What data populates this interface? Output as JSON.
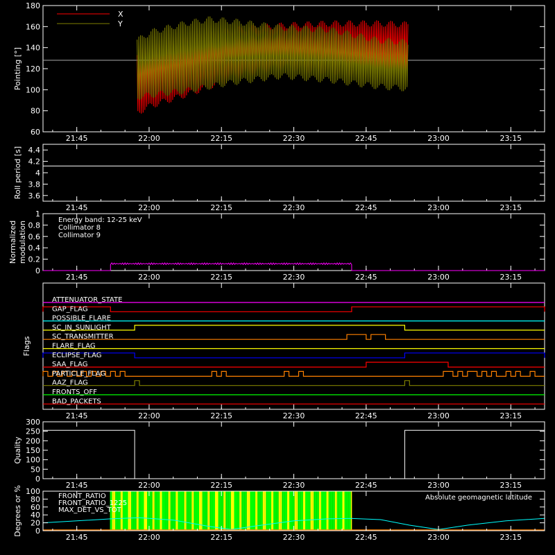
{
  "time_ticks": [
    "21:45",
    "22:00",
    "22:15",
    "22:30",
    "22:45",
    "23:00",
    "23:15"
  ],
  "chart_data": [
    {
      "type": "line",
      "ylabel": "Pointing [°]",
      "ylim": [
        60,
        180
      ],
      "yticks": [
        60,
        80,
        100,
        120,
        140,
        160,
        180
      ],
      "x_unit": "time",
      "reference_line": 128,
      "series": [
        {
          "name": "X",
          "color": "#ff0000",
          "band_start": "21:57:30",
          "band_end": "22:53:45",
          "upper": [
            [
              0,
              138
            ],
            [
              3,
              142
            ],
            [
              10,
              150
            ],
            [
              20,
              160
            ],
            [
              30,
              164
            ],
            [
              40,
              166
            ],
            [
              50,
              166
            ],
            [
              56.25,
              165
            ]
          ],
          "lower": [
            [
              0,
              75
            ],
            [
              3,
              82
            ],
            [
              10,
              92
            ],
            [
              20,
              108
            ],
            [
              30,
              118
            ],
            [
              40,
              114
            ],
            [
              50,
              112
            ],
            [
              56.25,
              110
            ]
          ]
        },
        {
          "name": "Y",
          "color": "#808000",
          "band_start": "21:57:30",
          "band_end": "22:53:45",
          "upper": [
            [
              0,
              150
            ],
            [
              3,
              158
            ],
            [
              10,
              166
            ],
            [
              15,
              170
            ],
            [
              20,
              168
            ],
            [
              30,
              162
            ],
            [
              40,
              160
            ],
            [
              50,
              150
            ],
            [
              56.25,
              148
            ]
          ],
          "lower": [
            [
              0,
              90
            ],
            [
              3,
              92
            ],
            [
              10,
              96
            ],
            [
              20,
              104
            ],
            [
              30,
              110
            ],
            [
              40,
              106
            ],
            [
              50,
              100
            ],
            [
              56.25,
              98
            ]
          ]
        }
      ],
      "legend": "top-left"
    },
    {
      "type": "line",
      "ylabel": "Roll period [s]",
      "ylim": [
        3.5,
        4.5
      ],
      "yticks": [
        3.6,
        3.8,
        4.0,
        4.2,
        4.4
      ],
      "series": [
        {
          "name": "",
          "color": "#ffffff",
          "x": [
            "21:38",
            "23:22"
          ],
          "y": [
            4.12,
            4.12
          ]
        }
      ]
    },
    {
      "type": "line",
      "ylabel": "Normalized modulation",
      "ylim": [
        0,
        1.0
      ],
      "yticks": [
        0.0,
        0.2,
        0.4,
        0.6,
        0.8,
        1.0
      ],
      "legend_lines": [
        "Energy band: 12-25 keV",
        "Collimator 8",
        "Collimator 9"
      ],
      "legend_colors": [
        "#ffffff",
        "#00ffff",
        "#ff00ff"
      ],
      "series": [
        {
          "name": "Collimator 9",
          "color": "#ff00ff",
          "x": [
            "21:38",
            "21:52",
            "21:52",
            "22:42",
            "22:42",
            "23:22"
          ],
          "y": [
            0.0,
            0.0,
            0.12,
            0.12,
            0.0,
            0.0
          ]
        }
      ]
    },
    {
      "type": "line",
      "ylabel": "Flags",
      "flags": [
        {
          "name": "ATTENUATOR_STATE",
          "color": "#ff00ff",
          "on": []
        },
        {
          "name": "GAP_FLAG",
          "color": "#ff0000",
          "on": [
            [
              "21:38",
              "21:52"
            ],
            [
              "22:42",
              "23:22"
            ]
          ]
        },
        {
          "name": "POSSIBLE_FLARE",
          "color": "#00ffff",
          "on": []
        },
        {
          "name": "SC_IN_SUNLIGHT",
          "color": "#ffff00",
          "on": [
            [
              "21:57",
              "22:53"
            ]
          ]
        },
        {
          "name": "SC_TRANSMITTER",
          "color": "#ff8000",
          "on": [
            [
              "22:41",
              "22:45"
            ],
            [
              "22:46",
              "22:49"
            ]
          ]
        },
        {
          "name": "FLARE_FLAG",
          "color": "#ffff00",
          "on": []
        },
        {
          "name": "ECLIPSE_FLAG",
          "color": "#0000ff",
          "on": [
            [
              "21:38",
              "21:57"
            ],
            [
              "22:53",
              "23:22"
            ]
          ]
        },
        {
          "name": "SAA_FLAG",
          "color": "#ff0000",
          "on": [
            [
              "22:45",
              "23:02"
            ]
          ]
        },
        {
          "name": "PARTICLE_FLAG",
          "color": "#ff8000",
          "on": [
            [
              "21:38",
              "21:39"
            ],
            [
              "21:40",
              "21:41"
            ],
            [
              "21:42",
              "21:43"
            ],
            [
              "21:44",
              "21:45"
            ],
            [
              "21:46",
              "21:47"
            ],
            [
              "21:48",
              "21:49"
            ],
            [
              "21:50",
              "21:51"
            ],
            [
              "21:52",
              "21:53"
            ],
            [
              "21:54",
              "21:55"
            ],
            [
              "22:13",
              "22:14"
            ],
            [
              "22:15",
              "22:16"
            ],
            [
              "22:28",
              "22:29"
            ],
            [
              "22:31",
              "22:32"
            ],
            [
              "23:01",
              "23:03"
            ],
            [
              "23:04",
              "23:05"
            ],
            [
              "23:06",
              "23:08"
            ],
            [
              "23:09",
              "23:10"
            ],
            [
              "23:11",
              "23:12"
            ],
            [
              "23:14",
              "23:15"
            ],
            [
              "23:16",
              "23:17"
            ],
            [
              "23:19",
              "23:20"
            ]
          ]
        },
        {
          "name": "AAZ_FLAG",
          "color": "#808000",
          "on": [
            [
              "21:57",
              "21:58"
            ],
            [
              "22:53",
              "22:54"
            ]
          ]
        },
        {
          "name": "FRONTS_OFF",
          "color": "#00ff00",
          "on": []
        },
        {
          "name": "BAD_PACKETS",
          "color": "#ff0000",
          "on": []
        }
      ]
    },
    {
      "type": "line",
      "ylabel": "Quality",
      "ylim": [
        0,
        300
      ],
      "yticks": [
        0,
        50,
        100,
        150,
        200,
        250,
        300
      ],
      "series": [
        {
          "name": "",
          "color": "#ffffff",
          "x": [
            "21:38",
            "21:57",
            "21:57",
            "22:53",
            "22:53",
            "23:22"
          ],
          "y": [
            255,
            255,
            0,
            0,
            255,
            255
          ]
        }
      ]
    },
    {
      "type": "bar",
      "ylabel": "Degrees or %",
      "ylim": [
        0,
        100
      ],
      "yticks": [
        0,
        20,
        40,
        60,
        80,
        100
      ],
      "legend_left": [
        "FRONT_RATIO",
        "FRONT_RATIO_1225",
        "MAX_DET_VS_TOT"
      ],
      "legend_left_colors": [
        "#ffff00",
        "#00ff00",
        "#ff8000"
      ],
      "legend_right": "Absolute geomagnetic latitude",
      "legend_right_color": "#00ffff",
      "front_ratio_range": [
        "21:52",
        "22:42"
      ],
      "latitude_curve": [
        [
          "21:38",
          20
        ],
        [
          "21:45",
          25
        ],
        [
          "21:52",
          30
        ],
        [
          "21:58",
          33
        ],
        [
          "22:05",
          27
        ],
        [
          "22:12",
          12
        ],
        [
          "22:17",
          3
        ],
        [
          "22:22",
          12
        ],
        [
          "22:30",
          25
        ],
        [
          "22:37",
          30
        ],
        [
          "22:42",
          31
        ],
        [
          "22:48",
          28
        ],
        [
          "22:54",
          14
        ],
        [
          "23:00",
          3
        ],
        [
          "23:06",
          14
        ],
        [
          "23:14",
          25
        ],
        [
          "23:22",
          31
        ]
      ]
    }
  ]
}
